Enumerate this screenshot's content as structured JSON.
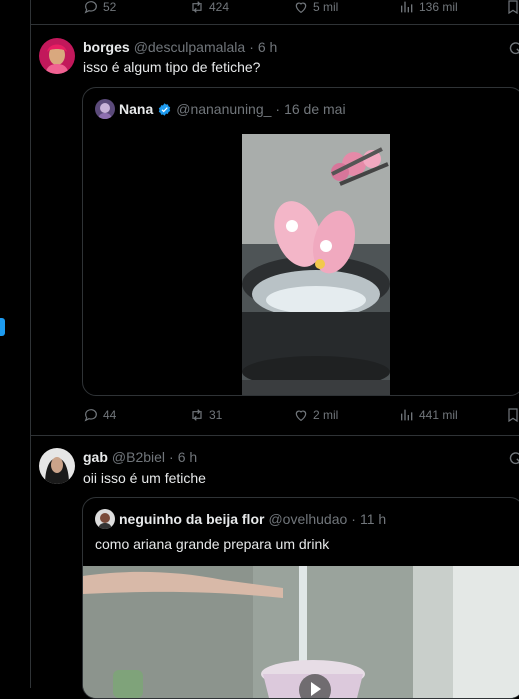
{
  "top_actions": {
    "replies": "52",
    "reposts": "424",
    "likes": "5 mil",
    "views": "136 mil"
  },
  "post1": {
    "name": "borges",
    "handle": "@desculpamalala",
    "sep": "·",
    "time": "6 h",
    "text": "isso é algum tipo de fetiche?",
    "quote": {
      "name": "Nana",
      "handle": "@nananuning_",
      "sep": "·",
      "date": "16 de mai"
    },
    "actions": {
      "replies": "44",
      "reposts": "31",
      "likes": "2 mil",
      "views": "441 mil"
    }
  },
  "post2": {
    "name": "gab",
    "handle": "@B2biel",
    "sep": "·",
    "time": "6 h",
    "text": "oii isso é um fetiche",
    "quote": {
      "name": "neguinho da beija flor",
      "handle": "@ovelhudao",
      "sep": "·",
      "time": "11 h",
      "text": "como ariana grande prepara um drink"
    }
  },
  "colors": {
    "accent": "#1d9bf0",
    "muted": "#71767b",
    "border": "#2f3336"
  }
}
